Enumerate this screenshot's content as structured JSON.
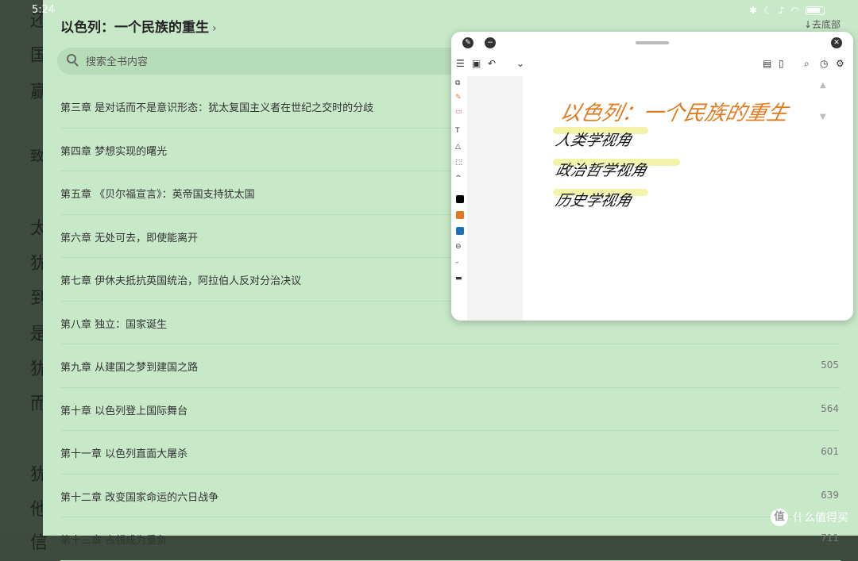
{
  "status": {
    "time": "5:24"
  },
  "background_chars": [
    "还",
    "国",
    "赢",
    "致",
    "太",
    "犹",
    "到",
    "是",
    "犹",
    "而",
    "犹",
    "他",
    "信"
  ],
  "drawer": {
    "title": "以色列：一个民族的重生",
    "title_chevron": "›",
    "goto_bottom": "↓去底部",
    "search": {
      "placeholder": "搜索全书内容"
    },
    "chapters": [
      {
        "label": "第三章 是对话而不是意识形态：犹太复国主义者在世纪之交时的分歧",
        "page": ""
      },
      {
        "label": "第四章 梦想实现的曙光",
        "page": ""
      },
      {
        "label": "第五章 《贝尔福宣言》：英帝国支持犹太国",
        "page": ""
      },
      {
        "label": "第六章 无处可去，即使能离开",
        "page": ""
      },
      {
        "label": "第七章 伊休夫抵抗英国统治，阿拉伯人反对分治决议",
        "page": ""
      },
      {
        "label": "第八章 独立：国家诞生",
        "page": ""
      },
      {
        "label": "第九章 从建国之梦到建国之路",
        "page": "505"
      },
      {
        "label": "第十章 以色列登上国际舞台",
        "page": "564"
      },
      {
        "label": "第十一章 以色列直面大屠杀",
        "page": "601"
      },
      {
        "label": "第十二章 改变国家命运的六日战争",
        "page": "639"
      },
      {
        "label": "第十三章 占领成为重负",
        "page": "711"
      }
    ]
  },
  "note": {
    "handwriting": {
      "title": "以色列：一个民族的重生",
      "lines": [
        "人类学视角",
        "政治哲学视角",
        "历史学视角"
      ]
    },
    "ink_colors": {
      "title": "#e07a1f",
      "lines": "#111111",
      "highlight": "#f1f3a3"
    },
    "swatches": [
      "#000000",
      "#e07a1f",
      "#1f6fb5"
    ]
  },
  "watermark": {
    "text": "什么值得买",
    "logo": "值"
  }
}
